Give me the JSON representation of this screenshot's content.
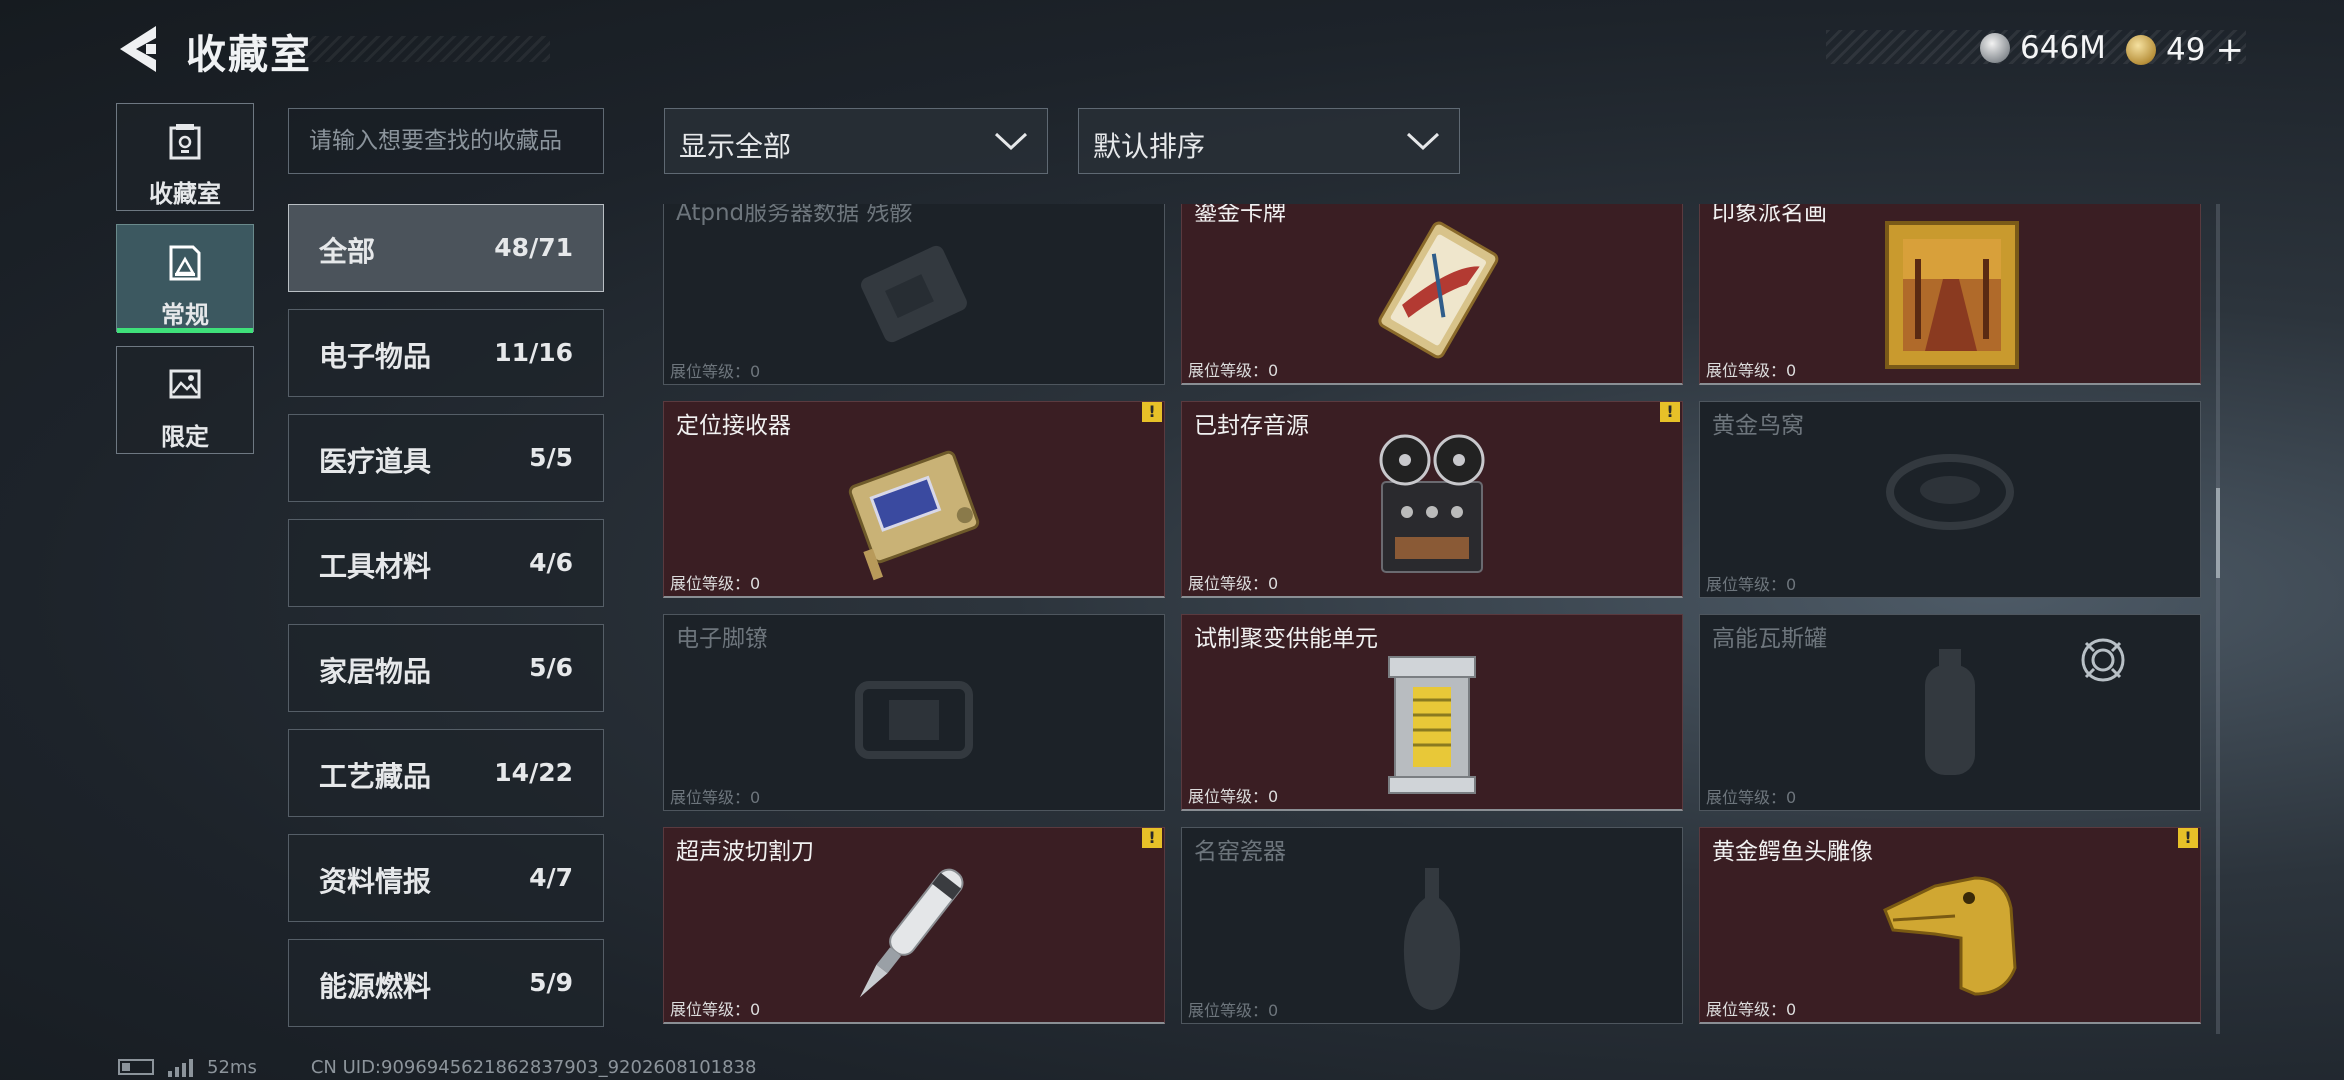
{
  "header": {
    "title": "收藏室"
  },
  "currency": {
    "silver": "646M",
    "gold": "49"
  },
  "modes": [
    {
      "label": "收藏室",
      "icon": "trophy-case-icon",
      "active": false
    },
    {
      "label": "常规",
      "icon": "framed-picture-icon",
      "active": true
    },
    {
      "label": "限定",
      "icon": "landscape-picture-icon",
      "active": false
    }
  ],
  "search": {
    "placeholder": "请输入想要查找的收藏品",
    "value": ""
  },
  "filters": {
    "show": "显示全部",
    "sort": "默认排序"
  },
  "categories": [
    {
      "name": "全部",
      "count": "48/71",
      "active": true
    },
    {
      "name": "电子物品",
      "count": "11/16"
    },
    {
      "name": "医疗道具",
      "count": "5/5"
    },
    {
      "name": "工具材料",
      "count": "4/6"
    },
    {
      "name": "家居物品",
      "count": "5/6"
    },
    {
      "name": "工艺藏品",
      "count": "14/22"
    },
    {
      "name": "资料情报",
      "count": "4/7"
    },
    {
      "name": "能源燃料",
      "count": "5/9"
    }
  ],
  "level_label": "展位等级：0",
  "items": [
    {
      "name": "Atpnd服务器数据 残骸",
      "unlocked": false,
      "warn": false,
      "icon": "server-module-icon"
    },
    {
      "name": "鎏金卡牌",
      "unlocked": true,
      "warn": false,
      "icon": "gilded-card-icon"
    },
    {
      "name": "印象派名画",
      "unlocked": true,
      "warn": false,
      "icon": "framed-painting-icon"
    },
    {
      "name": "定位接收器",
      "unlocked": true,
      "warn": true,
      "icon": "gps-receiver-icon"
    },
    {
      "name": "已封存音源",
      "unlocked": true,
      "warn": true,
      "icon": "reel-recorder-icon"
    },
    {
      "name": "黄金鸟窝",
      "unlocked": false,
      "warn": false,
      "icon": "bird-nest-icon"
    },
    {
      "name": "电子脚镣",
      "unlocked": false,
      "warn": false,
      "icon": "ankle-monitor-icon"
    },
    {
      "name": "试制聚变供能单元",
      "unlocked": true,
      "warn": false,
      "icon": "fusion-cell-icon"
    },
    {
      "name": "高能瓦斯罐",
      "unlocked": false,
      "warn": false,
      "icon": "gas-canister-icon"
    },
    {
      "name": "超声波切割刀",
      "unlocked": true,
      "warn": true,
      "icon": "ultrasonic-cutter-icon"
    },
    {
      "name": "名窑瓷器",
      "unlocked": false,
      "warn": false,
      "icon": "porcelain-vase-icon"
    },
    {
      "name": "黄金鳄鱼头雕像",
      "unlocked": true,
      "warn": true,
      "icon": "golden-crocodile-icon"
    }
  ],
  "footer": {
    "ping": "52ms",
    "uid": "CN UID:9096945621862837903_9202608101838"
  }
}
